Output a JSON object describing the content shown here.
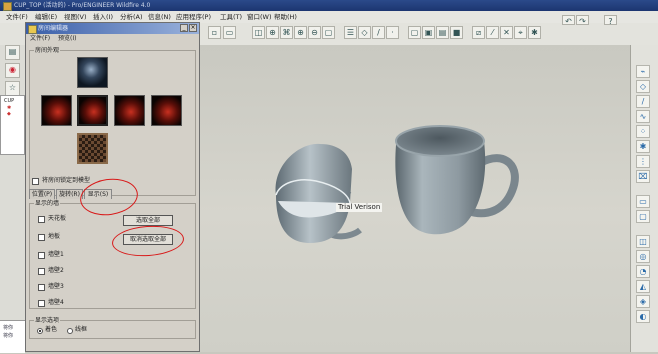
{
  "window": {
    "title": "CUP_TOP (活动的) - Pro/ENGINEER Wildfire 4.0"
  },
  "menubar": {
    "items": [
      {
        "label": "文件(F)"
      },
      {
        "label": "编辑(E)"
      },
      {
        "label": "视图(V)"
      },
      {
        "label": "插入(I)"
      },
      {
        "label": "分析(A)"
      },
      {
        "label": "信息(N)"
      },
      {
        "label": "应用程序(P)"
      },
      {
        "label": "工具(T)"
      },
      {
        "label": "窗口(W)"
      },
      {
        "label": "帮助(H)"
      }
    ]
  },
  "left_tree": {
    "root_label": "CUP"
  },
  "bottom_left": {
    "lines": [
      "将你",
      "将你"
    ]
  },
  "dialog": {
    "title": "房间编辑器",
    "menu": [
      {
        "label": "文件(F)"
      },
      {
        "label": "预览(I)"
      }
    ],
    "appearance_group": {
      "label": "房间外观"
    },
    "lock_checkbox": {
      "label": "将房间锁定到模型"
    },
    "tabs": [
      {
        "label": "位置(P)"
      },
      {
        "label": "旋转(R)"
      },
      {
        "label": "显示(S)"
      }
    ],
    "active_tab": "显示(S)",
    "walls_group": {
      "label": "显示的墙",
      "walls": [
        {
          "label": "天花板"
        },
        {
          "label": "地板"
        },
        {
          "label": "墙壁1"
        },
        {
          "label": "墙壁2"
        },
        {
          "label": "墙壁3"
        },
        {
          "label": "墙壁4"
        }
      ],
      "select_all": "选取全部",
      "deselect_all": "取消选取全部"
    },
    "display_options": {
      "label": "显示选项",
      "options": [
        {
          "label": "着色"
        },
        {
          "label": "线框"
        }
      ],
      "selected": "着色"
    }
  },
  "viewport": {
    "watermark": "Trial Verison"
  },
  "colors": {
    "annotation": "#d81818",
    "dialog_bg": "#d4d0c8",
    "cup": "#8f9ca3"
  },
  "icons": {
    "toolbar": [
      "new-icon",
      "open-icon",
      "save-icon",
      "print-icon",
      "undo-icon",
      "redo-icon",
      "repaint-icon",
      "zoom-in-icon",
      "zoom-out-icon",
      "refit-icon",
      "orient-icon",
      "view-manager-icon",
      "layers-icon",
      "wireframe-icon",
      "hidden-line-icon",
      "no-hidden-icon",
      "shading-icon",
      "datum-plane-icon",
      "datum-axis-icon",
      "datum-point-icon",
      "csys-icon"
    ],
    "rightbar": [
      "sketch-icon",
      "plane-icon",
      "axis-icon",
      "curve-icon",
      "point-icon",
      "csys-icon",
      "analysis-icon",
      "extrude-icon",
      "revolve-icon",
      "sweep-icon",
      "hole-icon",
      "round-icon",
      "shell-icon",
      "draft-icon"
    ]
  }
}
